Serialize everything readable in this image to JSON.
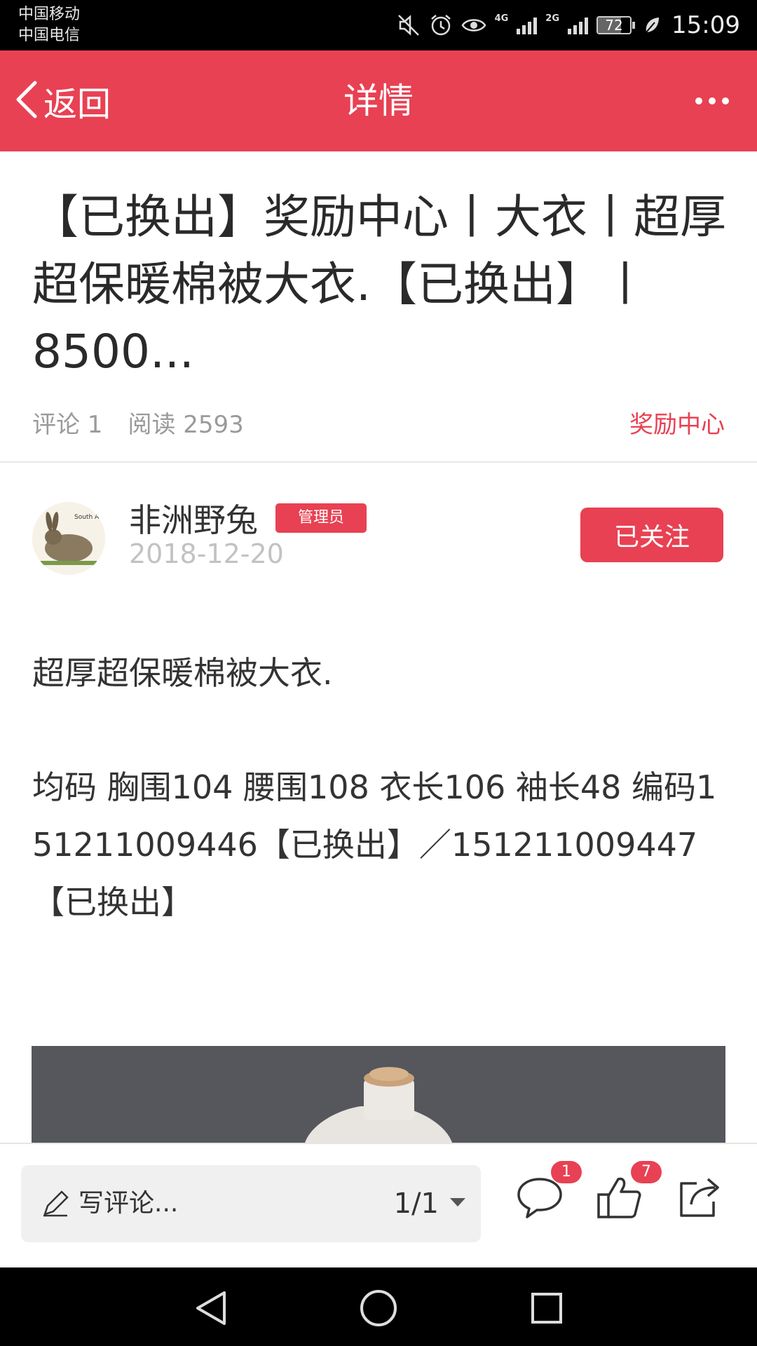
{
  "status_bar": {
    "carrier_1": "中国移动",
    "carrier_2": "中国电信",
    "net_1": "4G",
    "net_2": "2G",
    "battery": "72",
    "time": "15:09"
  },
  "header": {
    "back_label": "返回",
    "title": "详情"
  },
  "article": {
    "title": "【已换出】奖励中心丨大衣丨超厚超保暖棉被大衣.【已换出】丨8500...",
    "comments": "评论 1",
    "reads": "阅读 2593",
    "category": "奖励中心"
  },
  "author": {
    "name": "非洲野兔",
    "badge": "管理员",
    "date": "2018-12-20",
    "follow_label": "已关注"
  },
  "body": {
    "line1": "超厚超保暖棉被大衣.",
    "line2": "均码  胸围104   腰围108   衣长106   袖长48  编码151211009446【已换出】／151211009447【已换出】"
  },
  "bottom_bar": {
    "comment_placeholder": "写评论...",
    "pager": "1/1",
    "comment_count": "1",
    "like_count": "7"
  },
  "colors": {
    "accent": "#e84153",
    "status_bar": "#000000"
  },
  "icons": [
    "mute-icon",
    "alarm-icon",
    "eye-icon",
    "signal-icon",
    "battery-icon",
    "leaf-icon",
    "back-chevron-icon",
    "more-dots-icon",
    "pencil-icon",
    "dropdown-triangle-icon",
    "comment-icon",
    "thumbs-up-icon",
    "share-icon",
    "nav-back-icon",
    "nav-home-icon",
    "nav-recents-icon"
  ]
}
